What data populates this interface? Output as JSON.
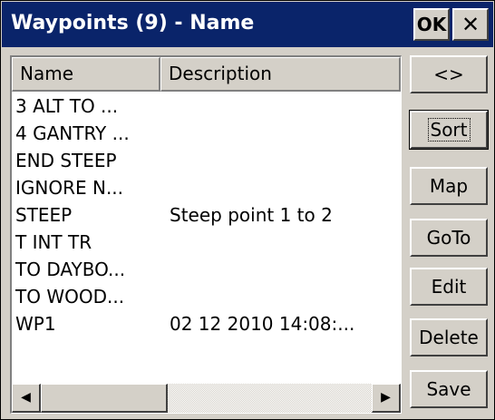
{
  "window": {
    "title": "Waypoints (9) - Name"
  },
  "titlebar": {
    "ok_label": "OK",
    "close_label": "✕"
  },
  "list": {
    "columns": [
      "Name",
      "Description"
    ],
    "rows": [
      {
        "name": "3 ALT TO ...",
        "description": ""
      },
      {
        "name": "4 GANTRY ...",
        "description": ""
      },
      {
        "name": "END STEEP",
        "description": ""
      },
      {
        "name": "IGNORE N...",
        "description": ""
      },
      {
        "name": "STEEP",
        "description": "Steep point 1 to 2"
      },
      {
        "name": "T INT TR",
        "description": ""
      },
      {
        "name": "TO DAYBO...",
        "description": ""
      },
      {
        "name": "TO WOOD...",
        "description": ""
      },
      {
        "name": "WP1",
        "description": "02 12 2010 14:08:..."
      }
    ]
  },
  "scrollbar": {
    "left_arrow": "◀",
    "right_arrow": "▶"
  },
  "buttons": {
    "swap": "<>",
    "sort": "Sort",
    "map": "Map",
    "goto": "GoTo",
    "edit": "Edit",
    "delete": "Delete",
    "save": "Save"
  }
}
